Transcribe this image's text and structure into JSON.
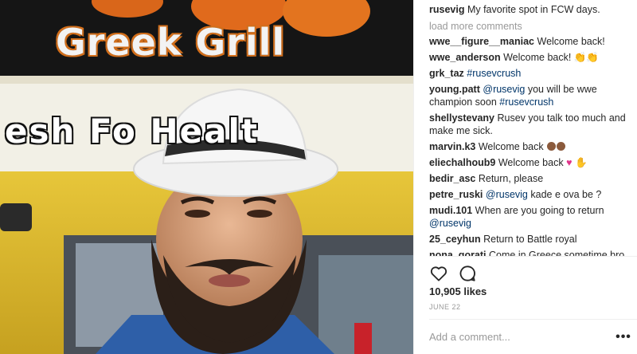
{
  "photo": {
    "sign_top_text": "Greek Grill",
    "sign_banner_text": "esh Fo  Healt"
  },
  "comments": {
    "caption": {
      "user": "rusevig",
      "text": "My favorite spot in FCW days."
    },
    "load_more": "load more comments",
    "items": [
      {
        "user": "wwe__figure__maniac",
        "text": "Welcome back!"
      },
      {
        "user": "wwe_anderson",
        "text": "Welcome back!"
      },
      {
        "user": "grk_taz",
        "tag": "#rusevcrush"
      },
      {
        "user": "young.patt",
        "tag": "@rusevig",
        "text": "you will be wwe champion soon",
        "tag2": "#rusevcrush"
      },
      {
        "user": "shellystevany",
        "text": "Rusev you talk too much and make me sick."
      },
      {
        "user": "marvin.k3",
        "text": "Welcome back"
      },
      {
        "user": "eliechalhoub9",
        "text": "Welcome back"
      },
      {
        "user": "bedir_asc",
        "text": "Return, please"
      },
      {
        "user": "petre_ruski",
        "tag": "@rusevig",
        "text": "kade e ova be ?"
      },
      {
        "user": "mudi.101",
        "text": "When are you going to return",
        "tag": "@rusevig"
      },
      {
        "user": "25_ceyhun",
        "text": "Return to Battle royal"
      },
      {
        "user": "nona_gorati",
        "text": "Come in Greece sometime bro"
      }
    ]
  },
  "actions": {
    "like_icon": "heart-icon",
    "comment_icon": "comment-bubble-icon"
  },
  "likes": "10,905 likes",
  "date": "JUNE 22",
  "add_comment": {
    "placeholder": "Add a comment..."
  },
  "more_options": "•••",
  "colors": {
    "link": "#003569",
    "muted": "#999999",
    "text": "#262626"
  }
}
